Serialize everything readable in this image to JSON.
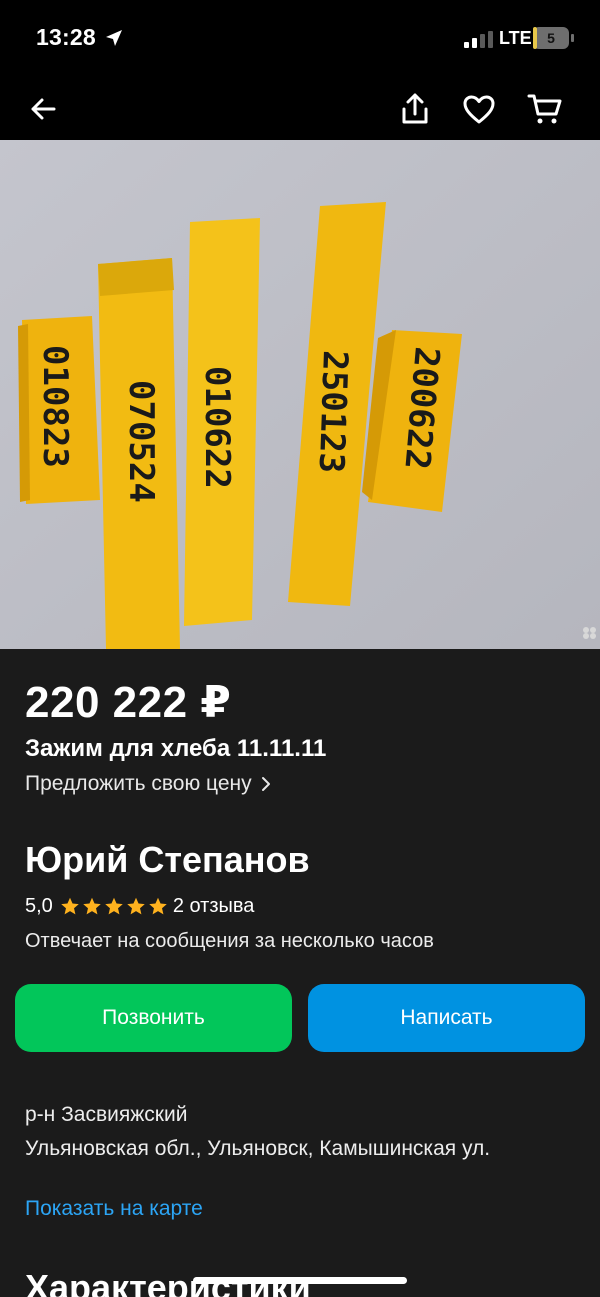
{
  "status_bar": {
    "time": "13:28",
    "network": "LTE",
    "battery_level": "5",
    "battery_fraction": 0.1,
    "location_icon": "location-arrow-icon",
    "signal_icon": "cellular-signal-icon"
  },
  "nav": {
    "back_icon": "back-arrow-icon",
    "share_icon": "share-icon",
    "favorite_icon": "heart-icon",
    "cart_icon": "cart-icon"
  },
  "listing": {
    "price": "220 222 ₽",
    "title": "Зажим для хлеба 11.11.11",
    "offer_price_link": "Предложить свою цену"
  },
  "seller": {
    "name": "Юрий Степанов",
    "rating": "5,0",
    "stars": 5,
    "reviews": "2 отзыва",
    "response_note": "Отвечает на сообщения за несколько часов"
  },
  "actions": {
    "call_label": "Позвонить",
    "write_label": "Написать"
  },
  "location": {
    "address": "р-н Засвияжский\nУльяновская обл., Ульяновск, Камышинская ул.",
    "map_link": "Показать на карте"
  },
  "sections": {
    "characteristics_title": "Характеристики"
  },
  "photo": {
    "tag_numbers": [
      "010823",
      "070524",
      "010622",
      "250123",
      "200622"
    ]
  },
  "colors": {
    "background": "#1b1b1b",
    "call_button": "#02c65a",
    "write_button": "#0092e1",
    "link": "#2ca5f5",
    "star": "#ffb21e",
    "tag_yellow": "#f2bb12"
  }
}
